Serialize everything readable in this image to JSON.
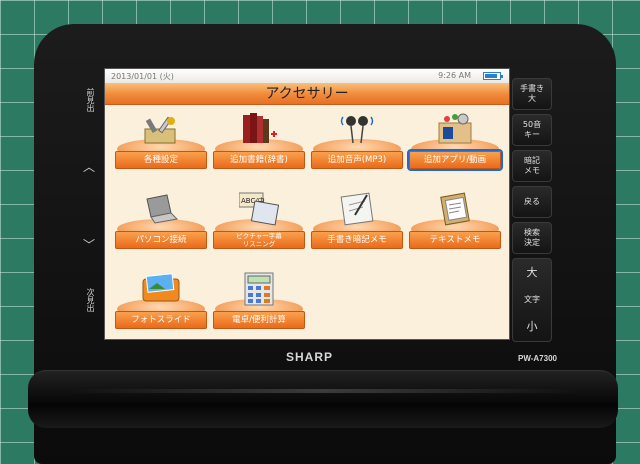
{
  "status": {
    "date": "2013/01/01 (火)",
    "time": "9:26 AM"
  },
  "title": "アクセサリー",
  "items": [
    {
      "label": "各種設定",
      "icon": "tools-icon"
    },
    {
      "label": "追加書籍(辞書)",
      "icon": "books-icon"
    },
    {
      "label": "追加音声(MP3)",
      "icon": "earphones-icon"
    },
    {
      "label": "追加アプリ/動画",
      "icon": "media-box-icon",
      "selected": true
    },
    {
      "label": "パソコン接続",
      "icon": "laptop-icon"
    },
    {
      "label": "ピクチャー字幕リスニング",
      "line1": "ピクチャー字幕",
      "line2": "リスニング",
      "icon": "picture-caption-icon"
    },
    {
      "label": "手書き暗記メモ",
      "icon": "handwriting-memo-icon"
    },
    {
      "label": "テキストメモ",
      "icon": "text-memo-icon"
    },
    {
      "label": "フォトスライド",
      "icon": "photo-slide-icon"
    },
    {
      "label": "電卓/便利計算",
      "icon": "calculator-icon"
    }
  ],
  "left_rail": {
    "top": "前見出",
    "bottom": "次見出",
    "up_icon": "chevron-up-icon",
    "down_icon": "chevron-down-icon"
  },
  "right_buttons": {
    "handwriting": {
      "line1": "手書き",
      "line2": "大"
    },
    "fifty_key": {
      "line1": "50音",
      "line2": "キー"
    },
    "memo": {
      "line1": "暗記",
      "line2": "メモ"
    },
    "back": "戻る",
    "search": {
      "line1": "検索",
      "line2": "決定"
    },
    "font": {
      "large": "大",
      "mid": "文字",
      "small": "小"
    }
  },
  "brand": "SHARP",
  "model": "PW-A7300",
  "colors": {
    "accent": "#ea6a1a",
    "selection": "#1a6ad8",
    "screen_bg": "#fbf0dc"
  }
}
